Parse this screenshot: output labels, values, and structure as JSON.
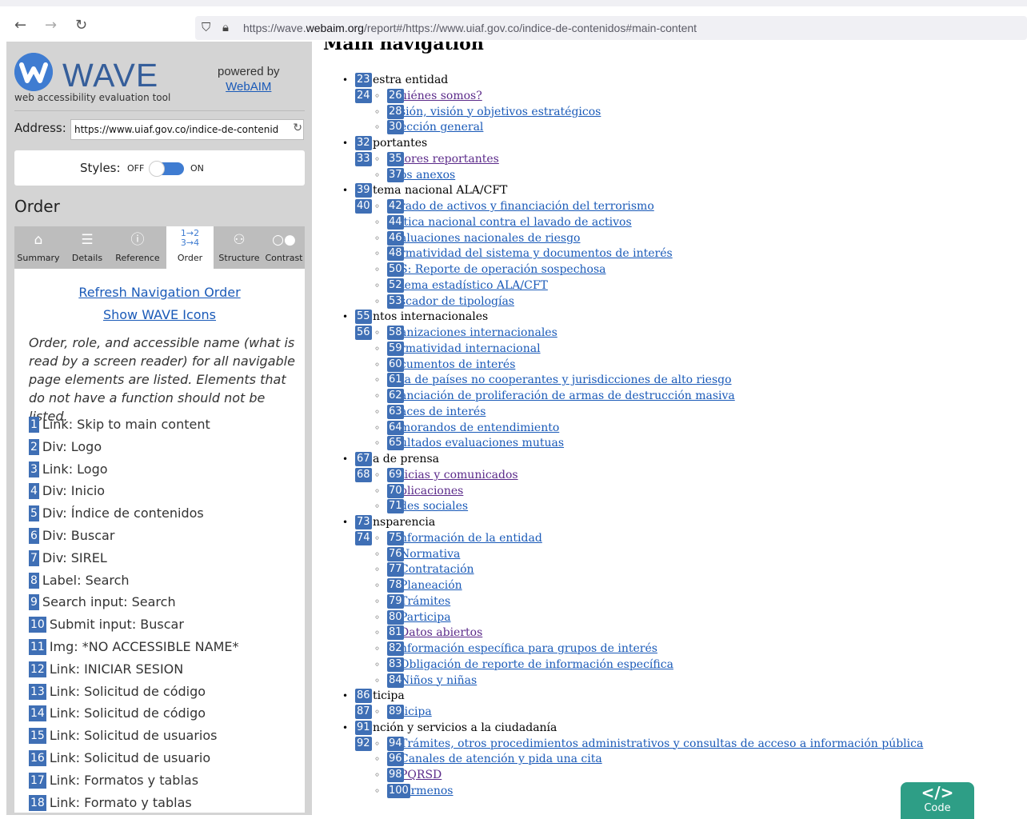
{
  "browser": {
    "url_prefix": "https://wave.",
    "url_domain": "webaim.org",
    "url_suffix": "/report#/https://www.uiaf.gov.co/indice-de-contenidos#main-content"
  },
  "sidebar": {
    "logo_text": "WAVE",
    "tagline": "web accessibility evaluation tool",
    "powered_by": "powered by",
    "webaim": "WebAIM",
    "address_label": "Address:",
    "address_value": "https://www.uiaf.gov.co/indice-de-contenid",
    "styles_label": "Styles:",
    "styles_off": "OFF",
    "styles_on": "ON",
    "order_heading": "Order",
    "tabs": [
      "Summary",
      "Details",
      "Reference",
      "Order",
      "Structure",
      "Contrast"
    ],
    "refresh_link": "Refresh Navigation Order",
    "show_icons_link": "Show WAVE Icons",
    "description": "Order, role, and accessible name (what is read by a screen reader) for all navigable page elements are listed. Elements that do not have a function should not be listed.",
    "order_items": [
      {
        "n": "1",
        "t": "Link: Skip to main content"
      },
      {
        "n": "2",
        "t": "Div: Logo"
      },
      {
        "n": "3",
        "t": "Link: Logo"
      },
      {
        "n": "4",
        "t": "Div: Inicio"
      },
      {
        "n": "5",
        "t": "Div: Índice de contenidos"
      },
      {
        "n": "6",
        "t": "Div: Buscar"
      },
      {
        "n": "7",
        "t": "Div: SIREL"
      },
      {
        "n": "8",
        "t": "Label: Search"
      },
      {
        "n": "9",
        "t": "Search input: Search"
      },
      {
        "n": "10",
        "t": "Submit input: Buscar"
      },
      {
        "n": "11",
        "t": "Img: *NO ACCESSIBLE NAME*"
      },
      {
        "n": "12",
        "t": "Link: INICIAR SESION"
      },
      {
        "n": "13",
        "t": "Link: Solicitud de código"
      },
      {
        "n": "14",
        "t": "Link: Solicitud de código"
      },
      {
        "n": "15",
        "t": "Link: Solicitud de usuarios"
      },
      {
        "n": "16",
        "t": "Link: Solicitud de usuario"
      },
      {
        "n": "17",
        "t": "Link: Formatos y tablas"
      },
      {
        "n": "18",
        "t": "Link: Formato y tablas"
      }
    ]
  },
  "content": {
    "heading": "Main navigation",
    "rows": [
      {
        "lvl": 1,
        "b": [
          "23"
        ],
        "text": "estra entidad",
        "link": false
      },
      {
        "lvl": 2,
        "b": [
          "24",
          "26"
        ],
        "text": "uiénes somos?",
        "link": true,
        "visited": true
      },
      {
        "lvl": 2,
        "b": [
          "28"
        ],
        "text": "sión, visión y objetivos estratégicos",
        "link": true
      },
      {
        "lvl": 2,
        "b": [
          "30"
        ],
        "text": "ección general",
        "link": true
      },
      {
        "lvl": 1,
        "b": [
          "32"
        ],
        "text": "portantes",
        "link": false
      },
      {
        "lvl": 2,
        "b": [
          "33",
          "35"
        ],
        "text": "tores reportantes",
        "link": true,
        "visited": true
      },
      {
        "lvl": 2,
        "b": [
          "37"
        ],
        "text": "os anexos",
        "link": true
      },
      {
        "lvl": 1,
        "b": [
          "39"
        ],
        "text": "tema nacional ALA/CFT",
        "link": false
      },
      {
        "lvl": 2,
        "b": [
          "40",
          "42"
        ],
        "text": "rado de activos y financiación del terrorismo",
        "link": true
      },
      {
        "lvl": 2,
        "b": [
          "44"
        ],
        "text": "ítica nacional contra el lavado de activos",
        "link": true
      },
      {
        "lvl": 2,
        "b": [
          "46"
        ],
        "text": "aluaciones nacionales de riesgo",
        "link": true
      },
      {
        "lvl": 2,
        "b": [
          "48"
        ],
        "text": "rmatividad del sistema y documentos de interés",
        "link": true
      },
      {
        "lvl": 2,
        "b": [
          "50"
        ],
        "text": "S: Reporte de operación sospechosa",
        "link": true
      },
      {
        "lvl": 2,
        "b": [
          "52"
        ],
        "text": "tema estadístico ALA/CFT",
        "link": true
      },
      {
        "lvl": 2,
        "b": [
          "53"
        ],
        "text": "scador de tipologías",
        "link": true
      },
      {
        "lvl": 1,
        "b": [
          "55"
        ],
        "text": "ntos internacionales",
        "link": false
      },
      {
        "lvl": 2,
        "b": [
          "56",
          "58"
        ],
        "text": "anizaciones internacionales",
        "link": true
      },
      {
        "lvl": 2,
        "b": [
          "59"
        ],
        "text": "rmatividad internacional",
        "link": true
      },
      {
        "lvl": 2,
        "b": [
          "60"
        ],
        "text": "cumentos de interés",
        "link": true
      },
      {
        "lvl": 2,
        "b": [
          "61"
        ],
        "text": "ta de países no cooperantes y jurisdicciones de alto riesgo",
        "link": true
      },
      {
        "lvl": 2,
        "b": [
          "62"
        ],
        "text": "anciación de proliferación de armas de destrucción masiva",
        "link": true
      },
      {
        "lvl": 2,
        "b": [
          "63"
        ],
        "text": "aces de interés",
        "link": true
      },
      {
        "lvl": 2,
        "b": [
          "64"
        ],
        "text": "morandos de entendimiento",
        "link": true
      },
      {
        "lvl": 2,
        "b": [
          "65"
        ],
        "text": "ultados evaluaciones mutuas",
        "link": true
      },
      {
        "lvl": 1,
        "b": [
          "67"
        ],
        "text": "a de prensa",
        "link": false
      },
      {
        "lvl": 2,
        "b": [
          "68",
          "69"
        ],
        "text": "ticias y comunicados",
        "link": true,
        "visited": true
      },
      {
        "lvl": 2,
        "b": [
          "70"
        ],
        "text": "blicaciones",
        "link": true,
        "visited": true
      },
      {
        "lvl": 2,
        "b": [
          "71"
        ],
        "text": "des sociales",
        "link": true
      },
      {
        "lvl": 1,
        "b": [
          "73"
        ],
        "text": "nsparencia",
        "link": false
      },
      {
        "lvl": 2,
        "b": [
          "74",
          "75"
        ],
        "text": "nformación de la entidad",
        "link": true
      },
      {
        "lvl": 2,
        "b": [
          "76"
        ],
        "text": "Normativa",
        "link": true
      },
      {
        "lvl": 2,
        "b": [
          "77"
        ],
        "text": "Contratación",
        "link": true
      },
      {
        "lvl": 2,
        "b": [
          "78"
        ],
        "text": "Planeación",
        "link": true
      },
      {
        "lvl": 2,
        "b": [
          "79"
        ],
        "text": "Trámites",
        "link": true
      },
      {
        "lvl": 2,
        "b": [
          "80"
        ],
        "text": "Participa",
        "link": true
      },
      {
        "lvl": 2,
        "b": [
          "81"
        ],
        "text": "Datos abiertos",
        "link": true,
        "visited": true
      },
      {
        "lvl": 2,
        "b": [
          "82"
        ],
        "text": "nformación específica para grupos de interés",
        "link": true
      },
      {
        "lvl": 2,
        "b": [
          "83"
        ],
        "text": "Obligación de reporte de información específica",
        "link": true
      },
      {
        "lvl": 2,
        "b": [
          "84"
        ],
        "text": " Niños y niñas",
        "link": true
      },
      {
        "lvl": 1,
        "b": [
          "86"
        ],
        "text": "ticipa",
        "link": false
      },
      {
        "lvl": 2,
        "b": [
          "87",
          "89"
        ],
        "text": "ticipa",
        "link": true
      },
      {
        "lvl": 1,
        "b": [
          "91"
        ],
        "text": "nción y servicios a la ciudadanía",
        "link": false
      },
      {
        "lvl": 2,
        "b": [
          "92",
          "94"
        ],
        "text": "Trámites, otros procedimientos administrativos y consultas de acceso a información pública",
        "link": true
      },
      {
        "lvl": 2,
        "b": [
          "96"
        ],
        "text": "Canales de atención y pida una cita",
        "link": true
      },
      {
        "lvl": 2,
        "b": [
          "98"
        ],
        "text": "PQRSD",
        "link": true,
        "visited": true
      },
      {
        "lvl": 2,
        "b": [
          "100"
        ],
        "text": "fórmenos",
        "link": true
      }
    ]
  },
  "code_button": {
    "glyph": "</>",
    "label": "Code"
  },
  "colors": {
    "accent": "#3f7cd1",
    "badge": "#3f6fb5",
    "link": "#1a5ab8",
    "visited": "#5b2a8a",
    "code": "#2e9e86"
  }
}
